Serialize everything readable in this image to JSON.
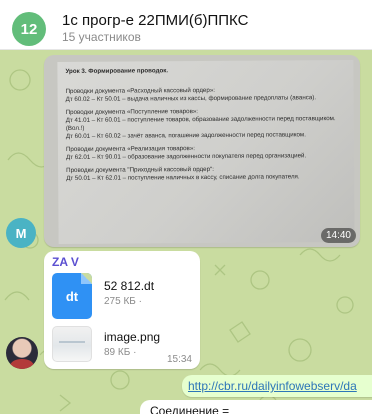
{
  "header": {
    "avatar_text": "12",
    "title": "1с прогр-е 22ПМИ(б)ППКС",
    "subtitle": "15 участников"
  },
  "photo_message": {
    "time": "14:40",
    "doc_lines": [
      "Урок 3. Формирование проводок.",
      "Проводки документа «Расходный кассовый ордер»:",
      "Дт 60.02 – Кт 50.01 – выдача наличных из кассы, формирование предоплаты (аванса).",
      "Проводки документа «Поступление товаров»:",
      "Дт 41.01 – Кт 60.01 – поступление товаров, образование задолженности перед поставщиком.",
      "(Вол.!)",
      "Дт 60.01 – Кт 60.02 – зачёт аванса, погашение задолженности перед поставщиком.",
      "Проводки документа «Реализация товаров»:",
      "Дт 62.01 – Кт 90.01 – образование задолженности покупателя перед организацией.",
      "Проводки документа \"Приходный кассовый ордер\":",
      "Дт 50.01 – Кт 62.01 – поступление наличных в кассу, списание долга покупателя."
    ]
  },
  "avatar_m": "M",
  "file_message": {
    "sender": "ZA V",
    "file1": {
      "icon_text": "dt",
      "name": "52 812.dt",
      "size": "275 КБ ·"
    },
    "file2": {
      "name": "image.png",
      "size": "89 КБ ·"
    },
    "time": "15:34"
  },
  "link_message": {
    "text": "http://cbr.ru/dailyinfowebserv/da"
  },
  "connection_message": {
    "text": "Соединение ="
  },
  "colors": {
    "chat_bg": "#c9dca0",
    "group_avatar": "#62bd7a",
    "sender_name": "#5b4fd1",
    "file_icon": "#2f91f4",
    "outgoing_bubble": "#e6ffcf",
    "link": "#2d76b8"
  }
}
